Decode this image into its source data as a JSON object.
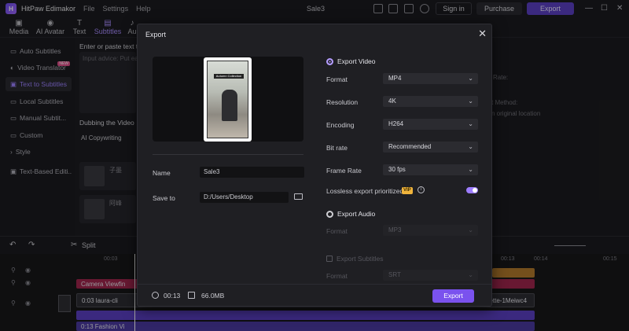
{
  "app": {
    "name": "HitPaw Edimakor",
    "doc_title": "Sale3"
  },
  "menu": [
    "File",
    "Settings",
    "Help"
  ],
  "topbar": {
    "signin": "Sign in",
    "purchase": "Purchase",
    "export": "Export",
    "controls": [
      "—",
      "☐",
      "✕"
    ]
  },
  "toolbar_tabs": [
    {
      "icon": "▣",
      "label": "Media"
    },
    {
      "icon": "◉",
      "label": "AI Avatar"
    },
    {
      "icon": "T",
      "label": "Text"
    },
    {
      "icon": "▤",
      "label": "Subtitles"
    },
    {
      "icon": "♪",
      "label": "Au"
    }
  ],
  "sidebar": {
    "items": [
      {
        "icon": "▭",
        "label": "Auto Subtitles"
      },
      {
        "icon": "◐",
        "label": "Video Translator",
        "badge": "NEW"
      },
      {
        "icon": "▣",
        "label": "Text to Subtitles"
      },
      {
        "icon": "▭",
        "label": "Local Subtitles"
      },
      {
        "icon": "▭",
        "label": "Manual Subtit..."
      },
      {
        "icon": "▭",
        "label": "Custom"
      },
      {
        "icon": "›",
        "label": "Style"
      },
      {
        "icon": "▣",
        "label": "Text-Based Editi..."
      }
    ]
  },
  "middle": {
    "title": "Enter or paste text t",
    "placeholder": "Input advice: Put ea",
    "ai_label": "AI Copywriting",
    "dubbing_title": "Dubbing the Video",
    "voice_name": "子墨",
    "voice_name2": "阿峰"
  },
  "right_panel": {
    "line1": "Rate:",
    "line2": "t Method:",
    "line3": "n original location"
  },
  "timeline": {
    "split": "Split",
    "ruler": [
      "00:03",
      "00:13",
      "00:14",
      "00:15"
    ],
    "tracks": [
      {
        "label": "Camera Viewfin"
      },
      {
        "label": "0:03  laura-cli"
      },
      {
        "label": "uette-1Meiwc4"
      },
      {
        "label": "0:13  Fashion Vi"
      }
    ]
  },
  "dialog": {
    "title": "Export",
    "name_label": "Name",
    "name_value": "Sale3",
    "save_label": "Save to",
    "save_value": "D:/Users/Desktop",
    "phone_banner": "Autumn Collection",
    "export_video": {
      "heading": "Export Video",
      "format_label": "Format",
      "format_value": "MP4",
      "resolution_label": "Resolution",
      "resolution_value": "4K",
      "encoding_label": "Encoding",
      "encoding_value": "H264",
      "bitrate_label": "Bit rate",
      "bitrate_value": "Recommended",
      "framerate_label": "Frame Rate",
      "framerate_value": "30  fps",
      "lossless_label": "Lossless export prioritized",
      "vip": "VIP",
      "lossless_on": true
    },
    "export_audio": {
      "heading": "Export Audio",
      "format_label": "Format",
      "format_value": "MP3"
    },
    "export_subtitles": {
      "heading": "Export Subtitles",
      "format_label": "Format",
      "format_value": "SRT"
    },
    "footer": {
      "duration": "00:13",
      "size": "66.0MB",
      "export_button": "Export"
    }
  },
  "colors": {
    "accent": "#7a52ee",
    "vip": "#f0b43c",
    "background": "#1f1f23"
  }
}
